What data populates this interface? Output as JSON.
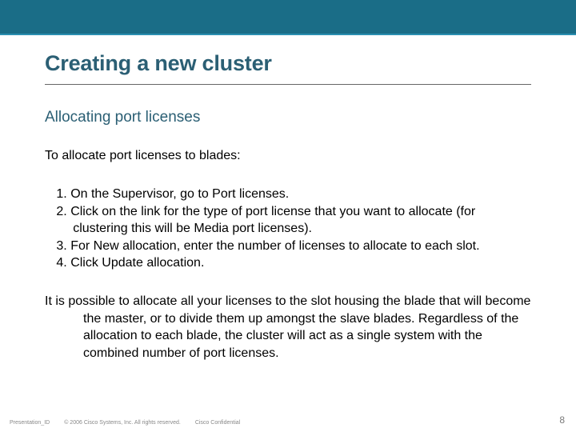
{
  "title": "Creating a new cluster",
  "subtitle": "Allocating port licenses",
  "intro": "To allocate port licenses to blades:",
  "steps": [
    "On the Supervisor, go to Port licenses.",
    "Click on the link for the type of port license that you want to allocate (for clustering this will be Media port licenses).",
    "For New allocation, enter the number of licenses to allocate to each slot.",
    " Click Update allocation."
  ],
  "note": "It is possible to allocate all your licenses to the slot housing the blade that will become the master, or to divide them up amongst the slave blades. Regardless of the allocation to each blade, the cluster will act as a single system with the combined number of port licenses.",
  "footer": {
    "presentation_id": "Presentation_ID",
    "copyright": "© 2006 Cisco Systems, Inc. All rights reserved.",
    "confidential": "Cisco Confidential",
    "page_number": "8"
  }
}
